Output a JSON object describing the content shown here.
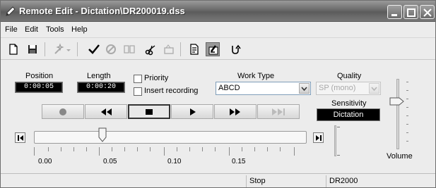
{
  "window": {
    "title": "Remote Edit - Dictation\\DR200019.dss"
  },
  "menu": [
    "File",
    "Edit",
    "Tools",
    "Help"
  ],
  "toolbar": {
    "icons": [
      "new-document-icon",
      "save-icon",
      "wand-icon",
      "dropdown-arrow-icon",
      "checkmark-icon",
      "cancel-icon",
      "book-icon",
      "scissors-icon",
      "paste-icon",
      "properties-icon",
      "settings-icon",
      "undo-icon"
    ]
  },
  "position": {
    "label": "Position",
    "value": "0:00:05"
  },
  "length": {
    "label": "Length",
    "value": "0:00:20"
  },
  "priority": {
    "label": "Priority",
    "checked": false
  },
  "insert_recording": {
    "label": "Insert recording",
    "checked": false
  },
  "work_type": {
    "label": "Work Type",
    "value": "ABCD"
  },
  "quality": {
    "label": "Quality",
    "value": "SP (mono)"
  },
  "sensitivity": {
    "label": "Sensitivity",
    "value": "Dictation"
  },
  "volume": {
    "label": "Volume",
    "level": 0.7
  },
  "transport": [
    "record-icon",
    "rewind-icon",
    "stop-icon",
    "play-icon",
    "fast-forward-icon",
    "skip-end-icon"
  ],
  "playback": {
    "position_fraction": 0.25
  },
  "ruler": {
    "labels": [
      "0.00",
      "0.05",
      "0.10",
      "0.15"
    ]
  },
  "status": {
    "cells": [
      "",
      "Stop",
      "DR2000"
    ]
  }
}
